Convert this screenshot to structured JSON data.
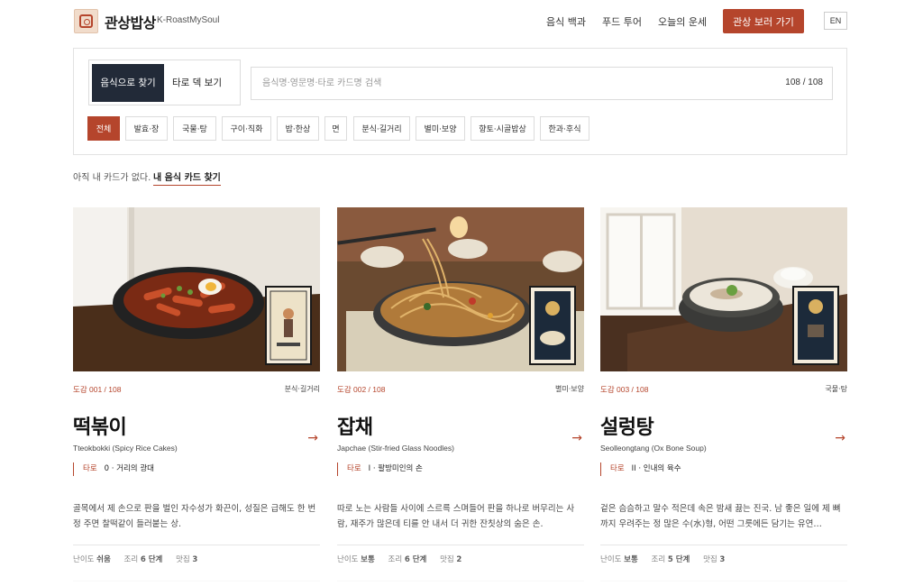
{
  "header": {
    "brand": "관상밥상",
    "brand_sub": "K-RoastMySoul",
    "nav": [
      "음식 백과",
      "푸드 투어",
      "오늘의 운세"
    ],
    "cta": "관상 보러 가기",
    "lang": "EN"
  },
  "search_panel": {
    "mode_active": "음식으로 찾기",
    "mode_other": "타로 덱 보기",
    "placeholder": "음식명·영문명·타로 카드명 검색",
    "count": "108 / 108",
    "chips": [
      "전체",
      "발효·장",
      "국물·탕",
      "구이·직화",
      "밥·한상",
      "면",
      "분식·길거리",
      "별미·보양",
      "향토·시골밥상",
      "한과·후식"
    ],
    "active_chip": "전체"
  },
  "no_card": {
    "text": "아직 내 카드가 없다.",
    "link": "내 음식 카드 찾기"
  },
  "cards": [
    {
      "index": "도감 001 / 108",
      "category": "분식·길거리",
      "title": "떡볶이",
      "subtitle": "Tteokbokki (Spicy Rice Cakes)",
      "tarot_label": "타로",
      "tarot_name": "0 · 거리의 광대",
      "desc": "골목에서 제 손으로 판을 벌인 자수성가 화끈이, 성질은 급해도 한 번 정 주면 찰떡같이 들러붙는 상.",
      "difficulty_label": "난이도",
      "difficulty": "쉬움",
      "steps_label": "조리",
      "steps": "6 단계",
      "spots_label": "맛집",
      "spots": "3"
    },
    {
      "index": "도감 002 / 108",
      "category": "별미·보양",
      "title": "잡채",
      "subtitle": "Japchae (Stir-fried Glass Noodles)",
      "tarot_label": "타로",
      "tarot_name": "I · 팔방미인의 손",
      "desc": "따로 노는 사람들 사이에 스르륵 스며들어 판을 하나로 버무리는 사람, 재주가 많은데 티를 안 내서 더 귀한 잔칫상의 숨은 손.",
      "difficulty_label": "난이도",
      "difficulty": "보통",
      "steps_label": "조리",
      "steps": "6 단계",
      "spots_label": "맛집",
      "spots": "2"
    },
    {
      "index": "도감 003 / 108",
      "category": "국물·탕",
      "title": "설렁탕",
      "subtitle": "Seolleongtang (Ox Bone Soup)",
      "tarot_label": "타로",
      "tarot_name": "II · 인내의 육수",
      "desc": "겉은 슴슴하고 말수 적은데 속은 밤새 끓는 진국. 남 좋은 일에 제 뼈까지 우려주는 정 많은 수(水)형, 어떤 그릇에든 담기는 유연…",
      "difficulty_label": "난이도",
      "difficulty": "보통",
      "steps_label": "조리",
      "steps": "5 단계",
      "spots_label": "맛집",
      "spots": "3"
    }
  ],
  "colors": {
    "accent": "#b5452c",
    "dark": "#222a38"
  }
}
